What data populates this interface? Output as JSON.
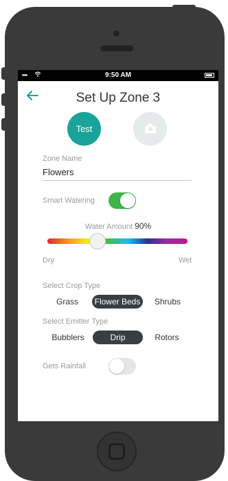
{
  "status_bar": {
    "signal": "••••",
    "time": "9:50 AM"
  },
  "header": {
    "title": "Set Up Zone 3"
  },
  "actions": {
    "test_label": "Test"
  },
  "zone_name": {
    "label": "Zone Name",
    "value": "Flowers"
  },
  "smart_watering": {
    "label": "Smart Watering",
    "on": true
  },
  "water_amount": {
    "label": "Water Amount",
    "value": "90%",
    "min_label": "Dry",
    "max_label": "Wet",
    "level": 0.36
  },
  "crop_type": {
    "label": "Select Crop Type",
    "options": [
      "Grass",
      "Flower Beds",
      "Shrubs"
    ],
    "selected": "Flower Beds"
  },
  "emitter_type": {
    "label": "Select Emitter Type",
    "options": [
      "Bubblers",
      "Drip",
      "Rotors"
    ],
    "selected": "Drip"
  },
  "gets_rainfall": {
    "label": "Gets Rainfall",
    "on": false
  },
  "colors": {
    "accent": "#1aa39a",
    "toggle_on": "#3cb64a",
    "selected_pill": "#3a3d42"
  }
}
